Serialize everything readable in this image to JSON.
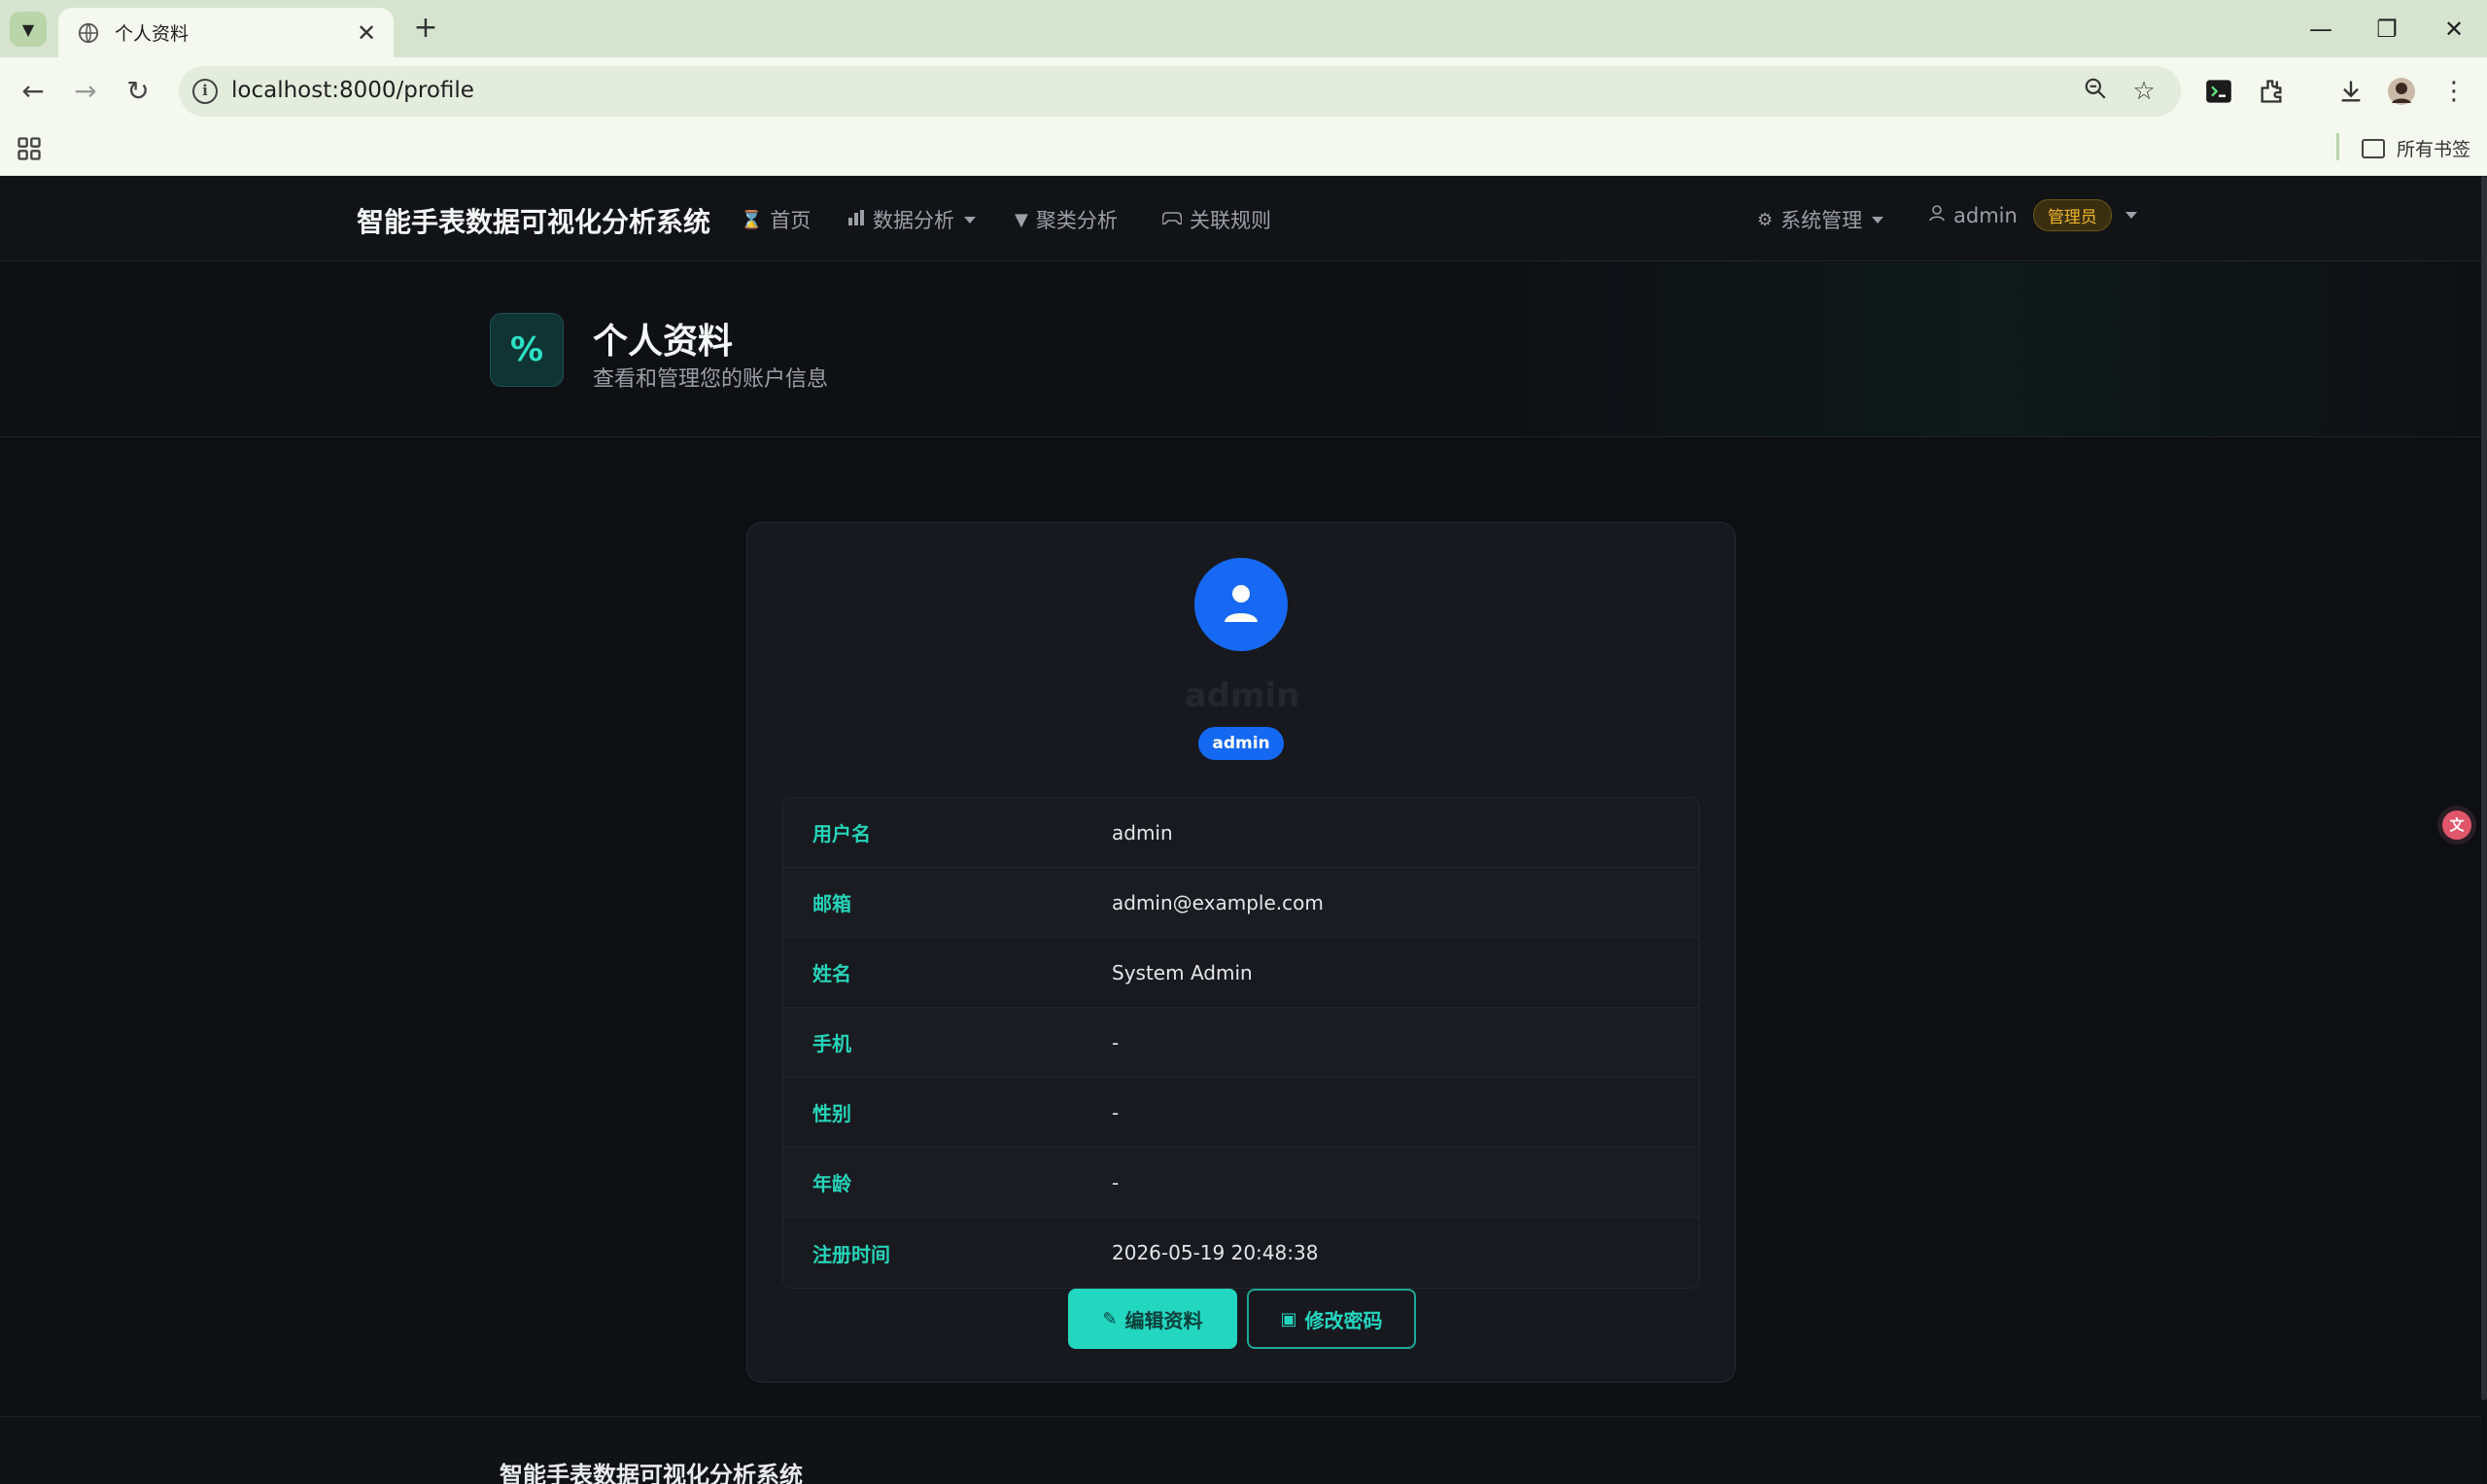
{
  "browser": {
    "tab_title": "个人资料",
    "tab_close": "✕",
    "new_tab": "+",
    "url": "localhost:8000/profile",
    "bookmarks_all": "所有书签",
    "window_controls": {
      "minimize": "—",
      "restore": "❐",
      "close": "✕"
    }
  },
  "navbar": {
    "brand": "智能手表数据可视化分析系统",
    "items": [
      {
        "label": "首页",
        "icon": "hourglass-icon"
      },
      {
        "label": "数据分析",
        "icon": "bar-chart-icon",
        "dropdown": true
      },
      {
        "label": "聚类分析",
        "icon": "thumbs-down-icon"
      },
      {
        "label": "关联规则",
        "icon": "gamepad-icon"
      }
    ],
    "system_menu": "系统管理",
    "user_name": "admin",
    "user_role_badge": "管理员"
  },
  "page_header": {
    "icon_glyph": "%",
    "title": "个人资料",
    "subtitle": "查看和管理您的账户信息"
  },
  "profile": {
    "display_name": "admin",
    "role_pill": "admin",
    "fields": [
      {
        "label": "用户名",
        "value": "admin"
      },
      {
        "label": "邮箱",
        "value": "admin@example.com"
      },
      {
        "label": "姓名",
        "value": "System Admin"
      },
      {
        "label": "手机",
        "value": "-"
      },
      {
        "label": "性别",
        "value": "-"
      },
      {
        "label": "年龄",
        "value": "-"
      },
      {
        "label": "注册时间",
        "value": "2026-05-19 20:48:38"
      }
    ],
    "edit_button": "编辑资料",
    "change_password_button": "修改密码"
  },
  "footer": {
    "title": "智能手表数据可视化分析系统"
  },
  "colors": {
    "accent": "#23d6c0",
    "brand_blue": "#1468f2",
    "role_badge": "#f0b429",
    "background": "#0e0f13"
  }
}
